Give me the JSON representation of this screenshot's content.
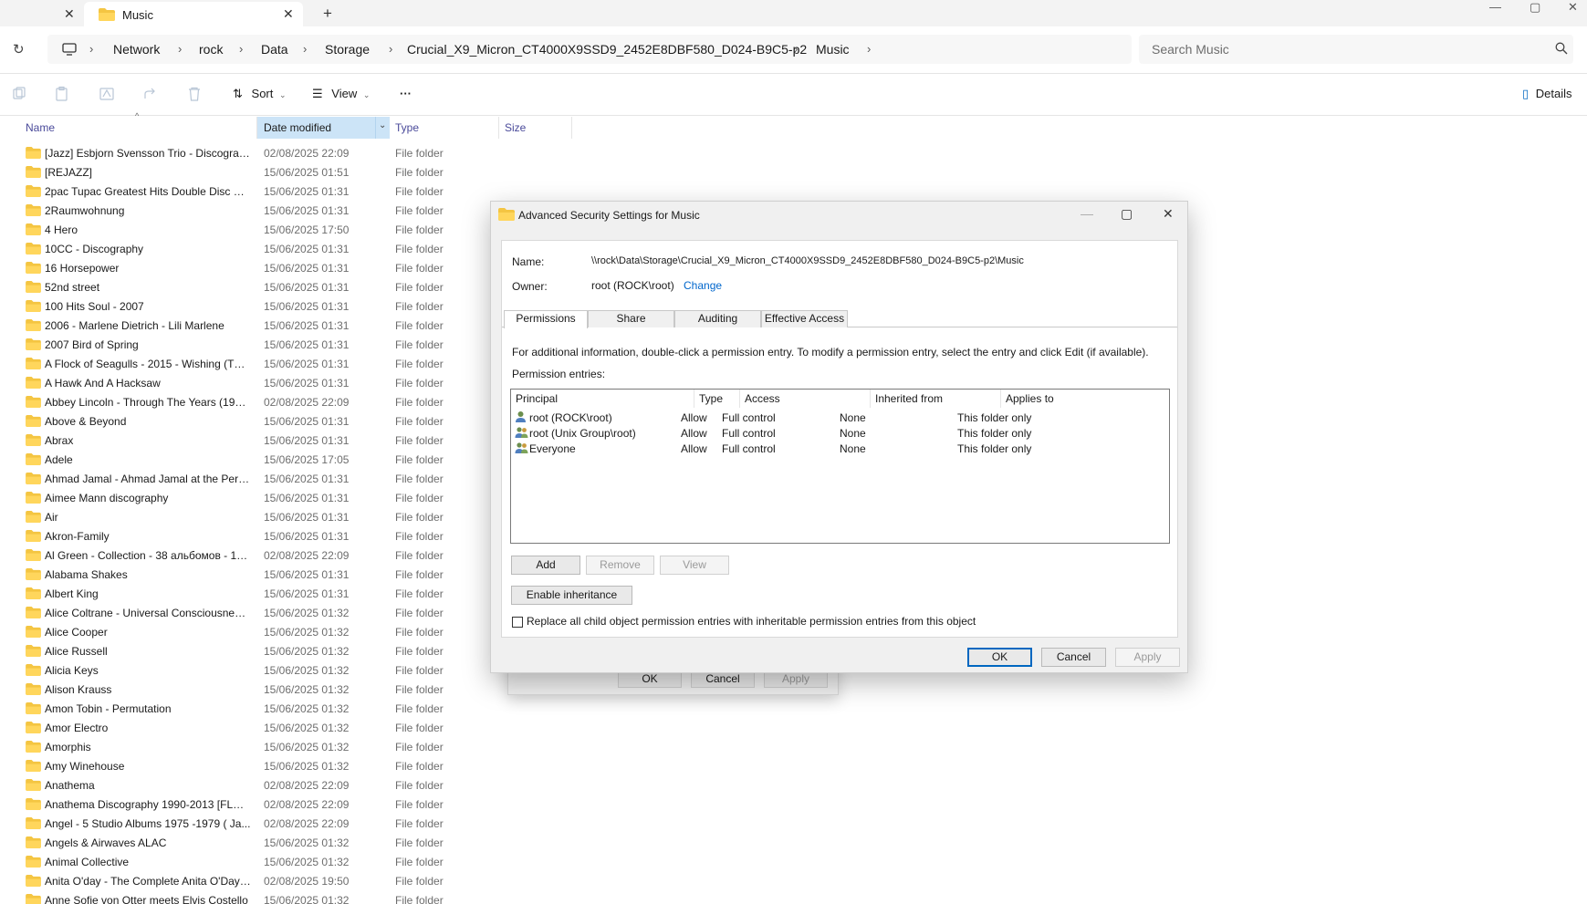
{
  "tabs": {
    "active_label": "Music"
  },
  "address": {
    "crumbs": [
      "Network",
      "rock",
      "Data",
      "Storage",
      "Crucial_X9_Micron_CT4000X9SSD9_2452E8DBF580_D024-B9C5-p2",
      "Music"
    ],
    "search_placeholder": "Search Music"
  },
  "toolbar": {
    "sort_label": "Sort",
    "view_label": "View",
    "more_label": "···",
    "details_label": "Details"
  },
  "columns": {
    "name": "Name",
    "date": "Date modified",
    "type": "Type",
    "size": "Size"
  },
  "files": [
    {
      "name": "[Jazz] Esbjorn Svensson Trio - Discograph...",
      "date": "02/08/2025 22:09",
      "type": "File folder"
    },
    {
      "name": "[REJAZZ]",
      "date": "15/06/2025 01:51",
      "type": "File folder"
    },
    {
      "name": "2pac Tupac Greatest Hits Double Disc FL...",
      "date": "15/06/2025 01:31",
      "type": "File folder"
    },
    {
      "name": "2Raumwohnung",
      "date": "15/06/2025 01:31",
      "type": "File folder"
    },
    {
      "name": "4 Hero",
      "date": "15/06/2025 17:50",
      "type": "File folder"
    },
    {
      "name": "10CC - Discography",
      "date": "15/06/2025 01:31",
      "type": "File folder"
    },
    {
      "name": "16 Horsepower",
      "date": "15/06/2025 01:31",
      "type": "File folder"
    },
    {
      "name": "52nd street",
      "date": "15/06/2025 01:31",
      "type": "File folder"
    },
    {
      "name": "100 Hits Soul - 2007",
      "date": "15/06/2025 01:31",
      "type": "File folder"
    },
    {
      "name": "2006 - Marlene Dietrich - Lili Marlene",
      "date": "15/06/2025 01:31",
      "type": "File folder"
    },
    {
      "name": "2007 Bird of Spring",
      "date": "15/06/2025 01:31",
      "type": "File folder"
    },
    {
      "name": "A Flock of Seagulls - 2015 - Wishing (The...",
      "date": "15/06/2025 01:31",
      "type": "File folder"
    },
    {
      "name": "A Hawk And A Hacksaw",
      "date": "15/06/2025 01:31",
      "type": "File folder"
    },
    {
      "name": "Abbey Lincoln - Through The Years (1956...",
      "date": "02/08/2025 22:09",
      "type": "File folder"
    },
    {
      "name": "Above & Beyond",
      "date": "15/06/2025 01:31",
      "type": "File folder"
    },
    {
      "name": "Abrax",
      "date": "15/06/2025 01:31",
      "type": "File folder"
    },
    {
      "name": "Adele",
      "date": "15/06/2025 17:05",
      "type": "File folder"
    },
    {
      "name": "Ahmad Jamal - Ahmad Jamal at the Pers...",
      "date": "15/06/2025 01:31",
      "type": "File folder"
    },
    {
      "name": "Aimee Mann discography",
      "date": "15/06/2025 01:31",
      "type": "File folder"
    },
    {
      "name": "Air",
      "date": "15/06/2025 01:31",
      "type": "File folder"
    },
    {
      "name": "Akron-Family",
      "date": "15/06/2025 01:31",
      "type": "File folder"
    },
    {
      "name": "Al Green - Collection - 38 альбомов - 19...",
      "date": "02/08/2025 22:09",
      "type": "File folder"
    },
    {
      "name": "Alabama Shakes",
      "date": "15/06/2025 01:31",
      "type": "File folder"
    },
    {
      "name": "Albert King",
      "date": "15/06/2025 01:31",
      "type": "File folder"
    },
    {
      "name": "Alice Coltrane - Universal Consciousness ...",
      "date": "15/06/2025 01:32",
      "type": "File folder"
    },
    {
      "name": "Alice Cooper",
      "date": "15/06/2025 01:32",
      "type": "File folder"
    },
    {
      "name": "Alice Russell",
      "date": "15/06/2025 01:32",
      "type": "File folder"
    },
    {
      "name": "Alicia Keys",
      "date": "15/06/2025 01:32",
      "type": "File folder"
    },
    {
      "name": "Alison Krauss",
      "date": "15/06/2025 01:32",
      "type": "File folder"
    },
    {
      "name": "Amon Tobin - Permutation",
      "date": "15/06/2025 01:32",
      "type": "File folder"
    },
    {
      "name": "Amor Electro",
      "date": "15/06/2025 01:32",
      "type": "File folder"
    },
    {
      "name": "Amorphis",
      "date": "15/06/2025 01:32",
      "type": "File folder"
    },
    {
      "name": "Amy Winehouse",
      "date": "15/06/2025 01:32",
      "type": "File folder"
    },
    {
      "name": "Anathema",
      "date": "02/08/2025 22:09",
      "type": "File folder"
    },
    {
      "name": "Anathema Discography 1990-2013 [FLAC...",
      "date": "02/08/2025 22:09",
      "type": "File folder"
    },
    {
      "name": "Angel - 5 Studio Albums  1975 -1979 ( Ja...",
      "date": "02/08/2025 22:09",
      "type": "File folder"
    },
    {
      "name": "Angels & Airwaves ALAC",
      "date": "15/06/2025 01:32",
      "type": "File folder"
    },
    {
      "name": "Animal Collective",
      "date": "15/06/2025 01:32",
      "type": "File folder"
    },
    {
      "name": "Anita O'day - The Complete Anita O'Day ...",
      "date": "02/08/2025 19:50",
      "type": "File folder"
    },
    {
      "name": "Anne Sofie von Otter meets Elvis Costello",
      "date": "15/06/2025 01:32",
      "type": "File folder"
    }
  ],
  "parent_dialog": {
    "ok": "OK",
    "cancel": "Cancel",
    "apply": "Apply"
  },
  "dialog": {
    "title": "Advanced Security Settings for Music",
    "name_label": "Name:",
    "name_value": "\\\\rock\\Data\\Storage\\Crucial_X9_Micron_CT4000X9SSD9_2452E8DBF580_D024-B9C5-p2\\Music",
    "owner_label": "Owner:",
    "owner_value": "root (ROCK\\root)",
    "change_link": "Change",
    "tabs": [
      "Permissions",
      "Share",
      "Auditing",
      "Effective Access"
    ],
    "info_text": "For additional information, double-click a permission entry. To modify a permission entry, select the entry and click Edit (if available).",
    "entries_label": "Permission entries:",
    "table_headers": [
      "Principal",
      "Type",
      "Access",
      "Inherited from",
      "Applies to"
    ],
    "entries": [
      {
        "principal": "root (ROCK\\root)",
        "type": "Allow",
        "access": "Full control",
        "inherited": "None",
        "applies": "This folder only"
      },
      {
        "principal": "root (Unix Group\\root)",
        "type": "Allow",
        "access": "Full control",
        "inherited": "None",
        "applies": "This folder only"
      },
      {
        "principal": "Everyone",
        "type": "Allow",
        "access": "Full control",
        "inherited": "None",
        "applies": "This folder only"
      }
    ],
    "add": "Add",
    "remove": "Remove",
    "view": "View",
    "enable_inheritance": "Enable inheritance",
    "replace_label": "Replace all child object permission entries with inheritable permission entries from this object",
    "ok": "OK",
    "cancel": "Cancel",
    "apply": "Apply"
  }
}
